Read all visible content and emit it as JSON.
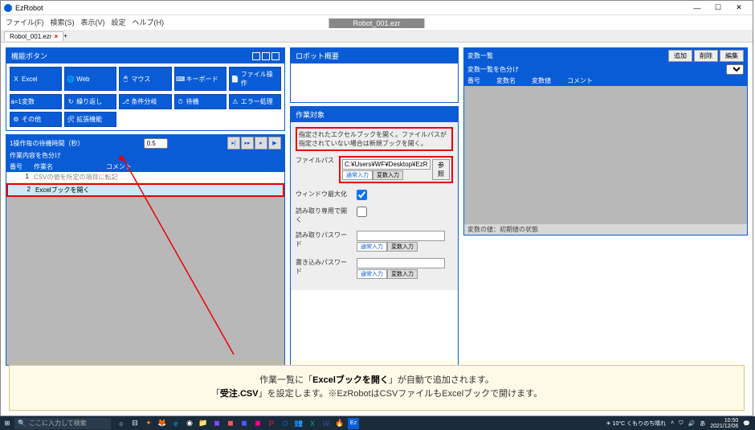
{
  "window": {
    "app_title": "EzRobot",
    "doc_title": "Robot_001.ezr"
  },
  "winctrl": {
    "min": "—",
    "max": "☐",
    "close": "✕"
  },
  "menu": {
    "file": "ファイル(F)",
    "search": "検索(S)",
    "view": "表示(V)",
    "settings": "設定",
    "help": "ヘルプ(H)"
  },
  "tab": {
    "name": "Robot_001.ezr",
    "close": "×",
    "add": "+"
  },
  "func_panel": {
    "title": "機能ボタン",
    "buttons": {
      "excel": "Excel",
      "web": "Web",
      "mouse": "マウス",
      "keyboard": "キーボード",
      "fileop": "ファイル操作",
      "var": "変数",
      "loop": "繰り返し",
      "branch": "条件分岐",
      "wait": "待機",
      "error": "エラー処理",
      "other": "その他",
      "ext": "拡張機能"
    }
  },
  "robot_panel": {
    "title": "ロボット概要"
  },
  "worklist": {
    "wait_label": "1操作毎の待機時間（秒）",
    "wait_value": "0.5",
    "colorize": "作業内容を色分け",
    "play": {
      "step": "STEP",
      "stepf": "STEP",
      "line": "LINE",
      "play": "PLAY"
    },
    "cols": {
      "no": "番号",
      "name": "作業名",
      "comment": "コメント"
    },
    "row1": {
      "no": "1",
      "name": "",
      "comment": "CSVの値を所定の項目に転記"
    },
    "row2": {
      "no": "2",
      "name": "Excelブックを開く",
      "comment": ""
    }
  },
  "target": {
    "title": "作業対象",
    "desc": "指定されたエクセルブックを開く。ファイルパスが指定されていない場合は新規ブックを開く。",
    "filepath_label": "ファイルパス",
    "filepath_value": "C:¥Users¥WF¥Desktop¥EzRo",
    "ref": "参照",
    "mode_normal": "通常入力",
    "mode_var": "変数入力",
    "maximize_label": "ウィンドウ最大化",
    "readonly_label": "読み取り専用で開く",
    "readpw_label": "読み取りパスワード",
    "writepw_label": "書き込みパスワード"
  },
  "vars": {
    "title": "変数一覧",
    "colorize": "変数一覧を色分け",
    "add": "追加",
    "del": "削除",
    "edit": "編集",
    "cols": {
      "no": "番号",
      "name": "変数名",
      "value": "変数値",
      "comment": "コメント"
    },
    "footer": "変数の値：初期値の状態"
  },
  "annotation": {
    "line1a": "作業一覧に「",
    "line1b": "Excelブックを開く",
    "line1c": "」が自動で追加されます。",
    "line2a": "「",
    "line2b": "受注.CSV",
    "line2c": "」を設定します。※EzRobotはCSVファイルもExcelブックで開けます。"
  },
  "taskbar": {
    "search_placeholder": "ここに入力して検索",
    "weather": "10°C くもりのち晴れ",
    "time": "10:50",
    "date": "2021/12/06"
  }
}
